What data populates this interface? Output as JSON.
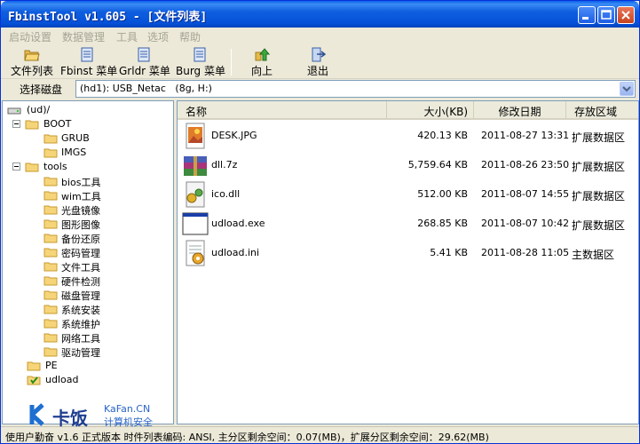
{
  "window": {
    "title": "FbinstTool v1.605 - [文件列表]"
  },
  "menu": [
    "启动设置",
    "数据管理",
    "工具",
    "选项",
    "帮助"
  ],
  "toolbar": [
    {
      "label": "文件列表",
      "icon": "folder-open-icon"
    },
    {
      "label": "Fbinst 菜单",
      "icon": "menu-doc-icon"
    },
    {
      "label": "Grldr 菜单",
      "icon": "menu-doc-icon"
    },
    {
      "label": "Burg 菜单",
      "icon": "menu-doc-icon"
    },
    {
      "label": "向上",
      "icon": "up-arrow-icon"
    },
    {
      "label": "退出",
      "icon": "exit-icon"
    }
  ],
  "disk": {
    "label": "选择磁盘",
    "value": "(hd1): USB_Netac   (8g, H:)"
  },
  "tree": {
    "root": "(ud)/",
    "nodes": [
      {
        "label": "BOOT",
        "children": [
          "GRUB",
          "IMGS"
        ]
      },
      {
        "label": "tools",
        "children": [
          "bios工具",
          "wim工具",
          "光盘镜像",
          "图形图像",
          "备份还原",
          "密码管理",
          "文件工具",
          "硬件检测",
          "磁盘管理",
          "系统安装",
          "系统维护",
          "网络工具",
          "驱动管理"
        ]
      },
      {
        "label": "PE",
        "children": []
      },
      {
        "label": "udload",
        "children": []
      }
    ]
  },
  "list": {
    "columns": [
      "名称",
      "大小(KB)",
      "修改日期",
      "存放区域"
    ],
    "rows": [
      {
        "name": "DESK.JPG",
        "size": "420.13 KB",
        "date": "2011-08-27 13:31",
        "area": "扩展数据区",
        "icon": "image-file-icon"
      },
      {
        "name": "dll.7z",
        "size": "5,759.64 KB",
        "date": "2011-08-26 23:50",
        "area": "扩展数据区",
        "icon": "archive-file-icon"
      },
      {
        "name": "ico.dll",
        "size": "512.00 KB",
        "date": "2011-08-07 14:55",
        "area": "扩展数据区",
        "icon": "dll-file-icon"
      },
      {
        "name": "udload.exe",
        "size": "268.85 KB",
        "date": "2011-08-07 10:42",
        "area": "扩展数据区",
        "icon": "exe-file-icon"
      },
      {
        "name": "udload.ini",
        "size": "5.41 KB",
        "date": "2011-08-28 11:05",
        "area": "主数据区",
        "icon": "ini-file-icon"
      }
    ]
  },
  "status": "使用户勤奋 v1.6 正式版本   时件列表编码: ANSI, 主分区剩余空间：0.07(MB)，扩展分区剩余空间：29.62(MB)",
  "watermark": {
    "brand": "卡饭",
    "domain": "KaFan.CN",
    "tagline": "计算机安全"
  },
  "colors": {
    "titlebar": "#0550d8",
    "menu_disabled": "#a5a394",
    "pane_border": "#7f9db9",
    "folder": "#f6d57a"
  }
}
